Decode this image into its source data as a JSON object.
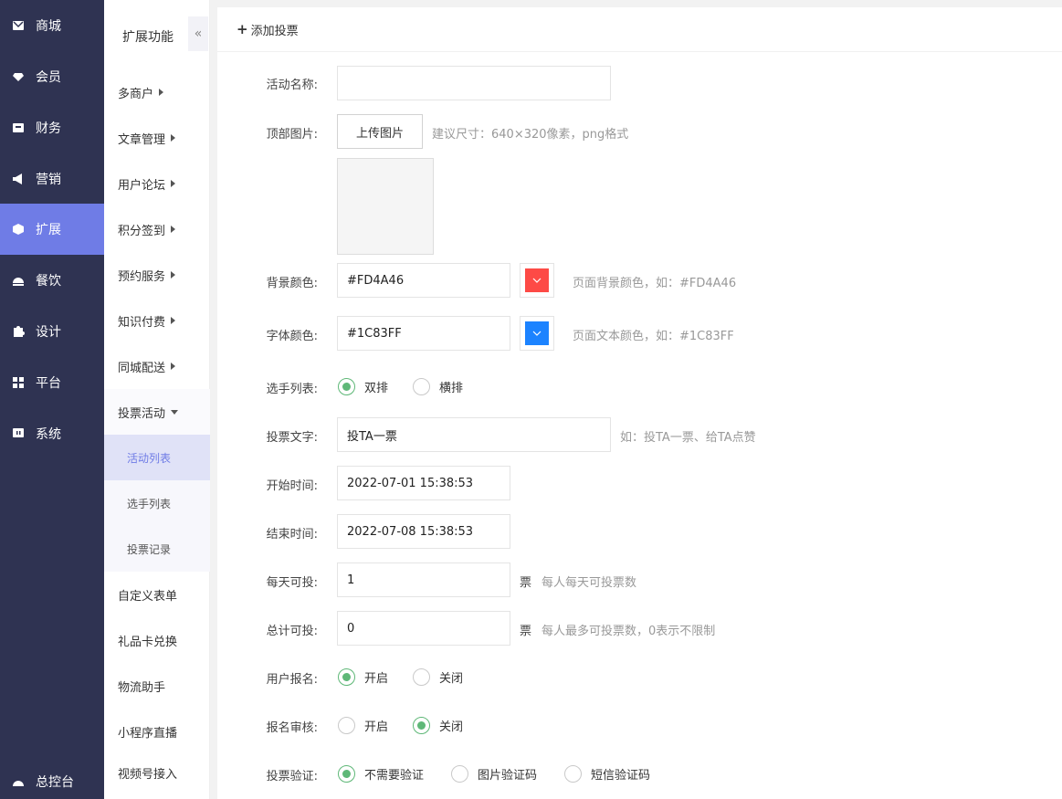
{
  "nav1": {
    "items": [
      {
        "label": "商城",
        "icon": "mail-icon"
      },
      {
        "label": "会员",
        "icon": "diamond-icon"
      },
      {
        "label": "财务",
        "icon": "wallet-icon"
      },
      {
        "label": "营销",
        "icon": "megaphone-icon"
      },
      {
        "label": "扩展",
        "icon": "cube-icon",
        "active": true
      },
      {
        "label": "餐饮",
        "icon": "dish-icon"
      },
      {
        "label": "设计",
        "icon": "puzzle-icon"
      },
      {
        "label": "平台",
        "icon": "grid-icon"
      },
      {
        "label": "系统",
        "icon": "monitor-icon"
      }
    ],
    "bottom_label": "总控台"
  },
  "nav2": {
    "title": "扩展功能",
    "collapse_glyph": "«",
    "items": [
      "多商户",
      "文章管理",
      "用户论坛",
      "积分签到",
      "预约服务",
      "知识付费",
      "同城配送",
      "投票活动"
    ],
    "sub_items": [
      "活动列表",
      "选手列表",
      "投票记录"
    ],
    "more_items": [
      "自定义表单",
      "礼品卡兑换",
      "物流助手",
      "小程序直播",
      "视频号接入"
    ]
  },
  "header": {
    "plus": "+",
    "title": "添加投票"
  },
  "form": {
    "name": {
      "label": "活动名称:",
      "value": ""
    },
    "banner": {
      "label": "顶部图片:",
      "button": "上传图片",
      "hint": "建议尺寸：640×320像素，png格式"
    },
    "bg_color": {
      "label": "背景颜色:",
      "value": "#FD4A46",
      "hint": "页面背景颜色，如：#FD4A46",
      "color": "#FD4A46"
    },
    "font_color": {
      "label": "字体颜色:",
      "value": "#1C83FF",
      "hint": "页面文本颜色，如：#1C83FF",
      "color": "#1C83FF"
    },
    "list_style": {
      "label": "选手列表:",
      "options": [
        "双排",
        "横排"
      ],
      "selected": 0
    },
    "vote_text": {
      "label": "投票文字:",
      "value": "投TA一票",
      "hint": "如：投TA一票、给TA点赞"
    },
    "start_time": {
      "label": "开始时间:",
      "value": "2022-07-01 15:38:53"
    },
    "end_time": {
      "label": "结束时间:",
      "value": "2022-07-08 15:38:53"
    },
    "daily": {
      "label": "每天可投:",
      "value": "1",
      "unit": "票",
      "hint": "每人每天可投票数"
    },
    "total": {
      "label": "总计可投:",
      "value": "0",
      "unit": "票",
      "hint": "每人最多可投票数，0表示不限制"
    },
    "signup": {
      "label": "用户报名:",
      "options": [
        "开启",
        "关闭"
      ],
      "selected": 0
    },
    "review": {
      "label": "报名审核:",
      "options": [
        "开启",
        "关闭"
      ],
      "selected": 1
    },
    "verify": {
      "label": "投票验证:",
      "options": [
        "不需要验证",
        "图片验证码",
        "短信验证码"
      ],
      "selected": 0
    }
  },
  "colors": {
    "nav_bg": "#2f3352",
    "accent": "#6f7ce6",
    "radio_checked": "#5fb878"
  }
}
